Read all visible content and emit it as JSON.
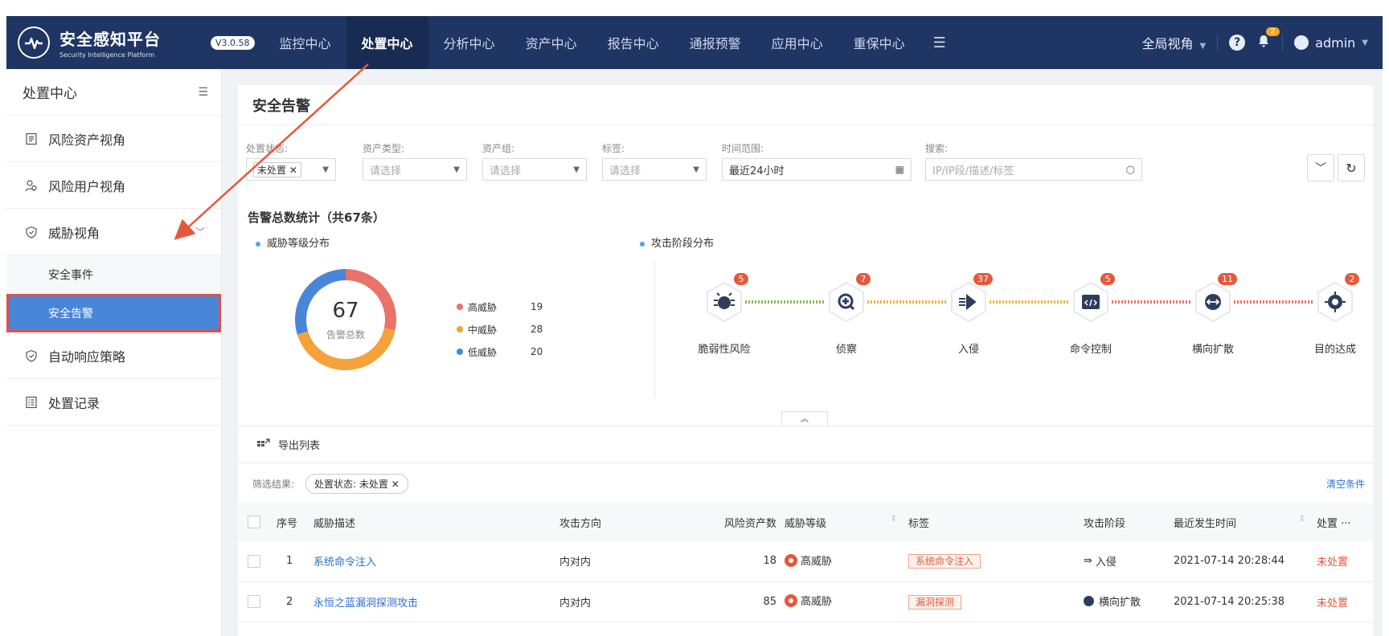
{
  "brand": {
    "title": "安全感知平台",
    "subtitle": "Security Intelligence Platform",
    "version": "V3.0.58"
  },
  "nav": {
    "items": [
      "监控中心",
      "处置中心",
      "分析中心",
      "资产中心",
      "报告中心",
      "通报预警",
      "应用中心",
      "重保中心"
    ],
    "active_index": 1
  },
  "topRight": {
    "view": "全局视角",
    "notification_count": "2",
    "user": "admin"
  },
  "sidebar": {
    "header": "处置中心",
    "items": [
      {
        "label": "风险资产视角",
        "icon": "document-icon"
      },
      {
        "label": "风险用户视角",
        "icon": "users-icon"
      },
      {
        "label": "威胁视角",
        "icon": "shield-icon"
      },
      {
        "label": "自动响应策略",
        "icon": "shield-check-icon"
      },
      {
        "label": "处置记录",
        "icon": "list-icon"
      }
    ],
    "sub_items": [
      "安全事件",
      "安全告警"
    ],
    "active_sub": "安全告警"
  },
  "panel": {
    "title": "安全告警"
  },
  "filters": {
    "status": {
      "label": "处置状态:",
      "value": "未处置"
    },
    "asset_type": {
      "label": "资产类型:",
      "placeholder": "请选择"
    },
    "asset_group": {
      "label": "资产组:",
      "placeholder": "请选择"
    },
    "tags": {
      "label": "标签:",
      "placeholder": "请选择"
    },
    "time_range": {
      "label": "时间范围:",
      "value": "最近24小时"
    },
    "search": {
      "label": "搜索:",
      "placeholder": "IP/IP段/描述/标签"
    }
  },
  "stats": {
    "title": "告警总数统计（共67条）",
    "level_title": "威胁等级分布",
    "stage_title": "攻击阶段分布",
    "total": "67",
    "total_label": "告警总数",
    "levels": [
      {
        "name": "高威胁",
        "value": 19,
        "color": "#e9736a"
      },
      {
        "name": "中威胁",
        "value": 28,
        "color": "#f5a23a"
      },
      {
        "name": "低威胁",
        "value": 20,
        "color": "#4a86d8"
      }
    ],
    "stages": [
      {
        "name": "脆弱性风险",
        "count": "5",
        "icon": "bug-icon"
      },
      {
        "name": "侦察",
        "count": "7",
        "icon": "magnifier-icon"
      },
      {
        "name": "入侵",
        "count": "37",
        "icon": "intrusion-arrow-icon"
      },
      {
        "name": "命令控制",
        "count": "5",
        "icon": "code-window-icon"
      },
      {
        "name": "横向扩散",
        "count": "11",
        "icon": "lateral-arrows-icon"
      },
      {
        "name": "目的达成",
        "count": "2",
        "icon": "target-icon"
      }
    ],
    "connector_colors": [
      "#8ab85a",
      "#f2b13c",
      "#f2b13c",
      "#e9736a",
      "#e9736a"
    ]
  },
  "list": {
    "export_label": "导出列表",
    "filter_result_label": "筛选结果:",
    "filter_chip": "处置状态:  未处置",
    "clear_label": "清空条件",
    "columns": [
      "序号",
      "威胁描述",
      "攻击方向",
      "风险资产数",
      "威胁等级",
      "标签",
      "攻击阶段",
      "最近发生时间",
      "处置"
    ],
    "rows": [
      {
        "no": "1",
        "desc": "系统命令注入",
        "direction": "内对内",
        "assets": "18",
        "level": "高威胁",
        "tag": "系统命令注入",
        "stage": "入侵",
        "time": "2021-07-14 20:28:44",
        "status": "未处置"
      },
      {
        "no": "2",
        "desc": "永恒之蓝漏洞探测攻击",
        "direction": "内对内",
        "assets": "85",
        "level": "高威胁",
        "tag": "漏洞探测",
        "stage": "横向扩散",
        "time": "2021-07-14 20:25:38",
        "status": "未处置"
      }
    ]
  }
}
